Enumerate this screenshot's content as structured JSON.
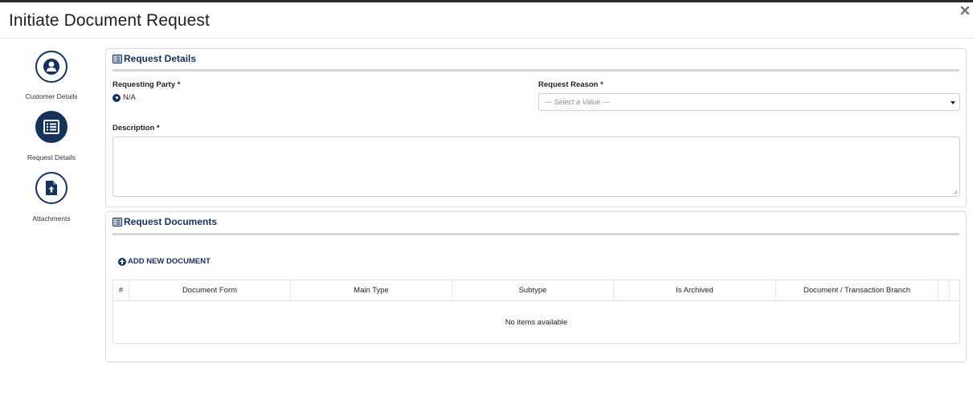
{
  "modal": {
    "title": "Initiate Document Request"
  },
  "wizard": {
    "steps": [
      {
        "label": "Customer Details",
        "icon": "user-icon",
        "state": "completed"
      },
      {
        "label": "Request Details",
        "icon": "list-icon",
        "state": "active"
      },
      {
        "label": "Attachments",
        "icon": "file-upload-icon",
        "state": "pending"
      }
    ]
  },
  "request_details": {
    "heading": "Request Details",
    "requesting_party": {
      "label": "Requesting Party",
      "required_mark": "*",
      "selected_option": "N/A"
    },
    "request_reason": {
      "label": "Request Reason",
      "required_mark": "*",
      "placeholder": "--- Select a Value ---"
    },
    "description": {
      "label": "Description",
      "required_mark": "*",
      "value": ""
    }
  },
  "request_documents": {
    "heading": "Request Documents",
    "add_button_label": "ADD NEW DOCUMENT",
    "columns": [
      "#",
      "Document Form",
      "Main Type",
      "Subtype",
      "Is Archived",
      "Document / Transaction Branch"
    ],
    "empty_message": "No items available"
  },
  "colors": {
    "accent": "#14325a",
    "border": "#dcdcdc",
    "rule": "#d6d6d6"
  }
}
